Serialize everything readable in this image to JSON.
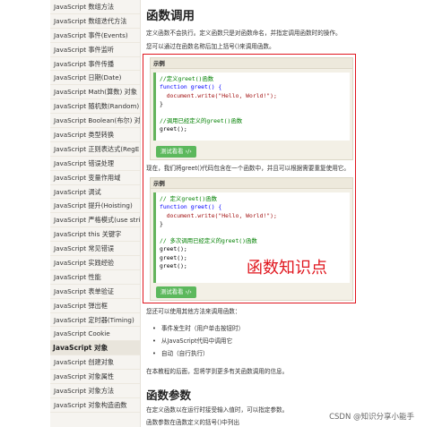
{
  "sidebar": {
    "items": [
      {
        "label": "JavaScript 数组方法",
        "section": false
      },
      {
        "label": "JavaScript 数组迭代方法",
        "section": false
      },
      {
        "label": "JavaScript 事件(Events)",
        "section": false
      },
      {
        "label": "JavaScript 事件监听",
        "section": false
      },
      {
        "label": "JavaScript 事件传播",
        "section": false
      },
      {
        "label": "JavaScript 日期(Date)",
        "section": false
      },
      {
        "label": "JavaScript Math(算数) 对象",
        "section": false
      },
      {
        "label": "JavaScript 随机数(Random)",
        "section": false
      },
      {
        "label": "JavaScript Boolean(布尔) 对",
        "section": false
      },
      {
        "label": "JavaScript 类型转换",
        "section": false
      },
      {
        "label": "JavaScript 正则表达式(RegE",
        "section": false
      },
      {
        "label": "JavaScript 错误处理",
        "section": false
      },
      {
        "label": "JavaScript 变量作用域",
        "section": false
      },
      {
        "label": "JavaScript 调试",
        "section": false
      },
      {
        "label": "JavaScript 提升(Hoisting)",
        "section": false
      },
      {
        "label": "JavaScript 严格模式(use stri",
        "section": false
      },
      {
        "label": "JavaScript this 关键字",
        "section": false
      },
      {
        "label": "JavaScript 常见错误",
        "section": false
      },
      {
        "label": "JavaScript 实践经验",
        "section": false
      },
      {
        "label": "JavaScript 性能",
        "section": false
      },
      {
        "label": "JavaScript 表单验证",
        "section": false
      },
      {
        "label": "JavaScript 弹出框",
        "section": false
      },
      {
        "label": "JavaScript 定时器(Timing)",
        "section": false
      },
      {
        "label": "JavaScript Cookie",
        "section": false
      },
      {
        "label": "JavaScript 对象",
        "section": true
      },
      {
        "label": "JavaScript 创建对象",
        "section": false
      },
      {
        "label": "JavaScript 对象属性",
        "section": false
      },
      {
        "label": "JavaScript 对象方法",
        "section": false
      },
      {
        "label": "JavaScript 对象构造函数",
        "section": false
      }
    ]
  },
  "main": {
    "title": "函数调用",
    "intro1": "定义函数不会执行。定义函数只是对函数命名，并指定调用函数时的操作。",
    "intro2": "您可以通过在函数名称后加上括号()来调用函数。",
    "example_label": "示例",
    "example1_code": [
      {
        "text": "//定义greet()函数",
        "cls": "cm"
      },
      {
        "text": "function greet() {",
        "cls": "kw"
      },
      {
        "text": "  document.write(\"Hello, World!\");",
        "cls": "str"
      },
      {
        "text": "}",
        "cls": ""
      },
      {
        "text": "",
        "cls": ""
      },
      {
        "text": "//调用已经定义的greet()函数",
        "cls": "cm"
      },
      {
        "text": "greet();",
        "cls": ""
      }
    ],
    "try_button": "测试看看 ›/›",
    "middle_text": "现在，我们将greet()代码包含在一个函数中，并且可以根据需要重复使用它。",
    "example2_code": [
      {
        "text": "// 定义greet()函数",
        "cls": "cm"
      },
      {
        "text": "function greet() {",
        "cls": "kw"
      },
      {
        "text": "  document.write(\"Hello, World!\");",
        "cls": "str"
      },
      {
        "text": "}",
        "cls": ""
      },
      {
        "text": "",
        "cls": ""
      },
      {
        "text": "// 多次调用已经定义的greet()函数",
        "cls": "cm"
      },
      {
        "text": "greet();",
        "cls": ""
      },
      {
        "text": "greet();",
        "cls": ""
      },
      {
        "text": "greet();",
        "cls": ""
      }
    ],
    "also_text": "您还可以使用其他方法来调用函数：",
    "bullets": [
      "事件发生时（用户单击按钮时）",
      "从JavaScript代码中调用它",
      "自动（自行执行）"
    ],
    "later_text": "在本教程的后面，您将学到更多有关函数调用的信息。",
    "section2_title": "函数参数",
    "section2_p1": "在定义函数以在运行时接受输入值时，可以指定参数。",
    "section2_p2": "函数参数在函数定义的括号()中列出"
  },
  "annotation": "函数知识点",
  "watermark": "CSDN @知识分享小能手"
}
